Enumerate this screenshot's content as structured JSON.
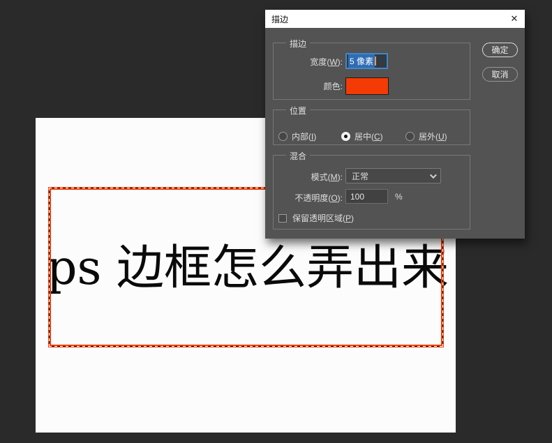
{
  "colors": {
    "stroke_red": "#f43b05",
    "selection_blue": "#2e6cb5",
    "focus_border_blue": "#3f87c9",
    "dialog_bg": "#535353",
    "workspace_bg": "#2a2a2a"
  },
  "window": {
    "title": "描边",
    "close_glyph": "✕"
  },
  "dialog": {
    "stroke_group": {
      "label": "描边",
      "width": {
        "pre": "宽度(",
        "key": "W",
        "post": "):",
        "value": "5 像素"
      },
      "color": {
        "label": "颜色:",
        "swatch": "#f43b05"
      }
    },
    "position_group": {
      "label": "位置",
      "options": [
        {
          "pre": "内部(",
          "key": "I",
          "post": ")",
          "selected": false
        },
        {
          "pre": "居中(",
          "key": "C",
          "post": ")",
          "selected": true
        },
        {
          "pre": "居外(",
          "key": "U",
          "post": ")",
          "selected": false
        }
      ]
    },
    "blend_group": {
      "label": "混合",
      "mode": {
        "pre": "模式(",
        "key": "M",
        "post": "):",
        "value": "正常"
      },
      "opacity": {
        "pre": "不透明度(",
        "key": "O",
        "post": "):",
        "value": "100",
        "unit": "%"
      },
      "preserve": {
        "pre": "保留透明区域(",
        "key": "P",
        "post": ")",
        "checked": false
      }
    },
    "buttons": {
      "ok": "确定",
      "cancel": "取消"
    }
  },
  "canvas": {
    "text": "ps 边框怎么弄出来"
  }
}
